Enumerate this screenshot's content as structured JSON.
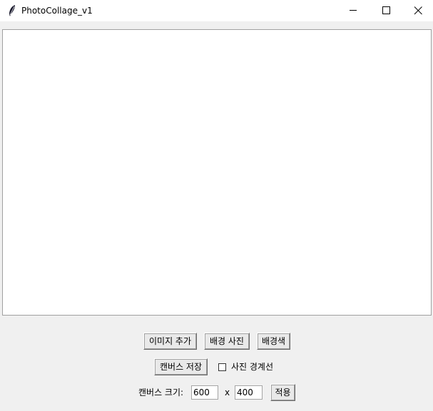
{
  "window": {
    "title": "PhotoCollage_v1",
    "icon": "feather-icon",
    "controls": [
      "minimize-icon",
      "maximize-icon",
      "close-icon"
    ]
  },
  "toolbar": {
    "add_image_label": "이미지 추가",
    "bg_photo_label": "배경 사진",
    "bg_color_label": "배경색",
    "save_canvas_label": "캔버스 저장",
    "border_checkbox_label": "사진 경계선",
    "border_checked": false
  },
  "canvas_size": {
    "label": "캔버스 크기:",
    "width_value": "600",
    "separator": "x",
    "height_value": "400",
    "apply_label": "적용"
  },
  "colors": {
    "window_bg": "#f0f0f0",
    "canvas_bg": "#ffffff"
  }
}
